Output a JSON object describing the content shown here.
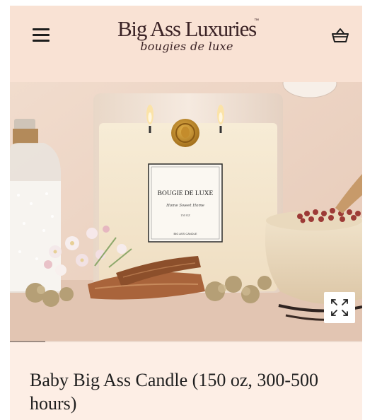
{
  "header": {
    "logo_main": "Big Ass Luxuries",
    "logo_tm": "™",
    "logo_sub": "bougies de luxe",
    "menu_icon": "hamburger-menu-icon",
    "cart_icon": "shopping-basket-icon"
  },
  "hero": {
    "candle_label_title": "BOUGIE DE LUXE",
    "candle_label_line1": "Home Sweet Home",
    "candle_label_line2": "150 OZ",
    "candle_label_brand": "BIG ASS CANDLE",
    "expand_icon": "expand-arrows-icon",
    "gallery_progress": 0.1
  },
  "product": {
    "title": "Baby Big Ass Candle (150 oz, 300-500 hours)"
  },
  "colors": {
    "header_bg": "#f9e2d4",
    "brand_text": "#3b2326",
    "title_bg": "#fdeee5"
  }
}
